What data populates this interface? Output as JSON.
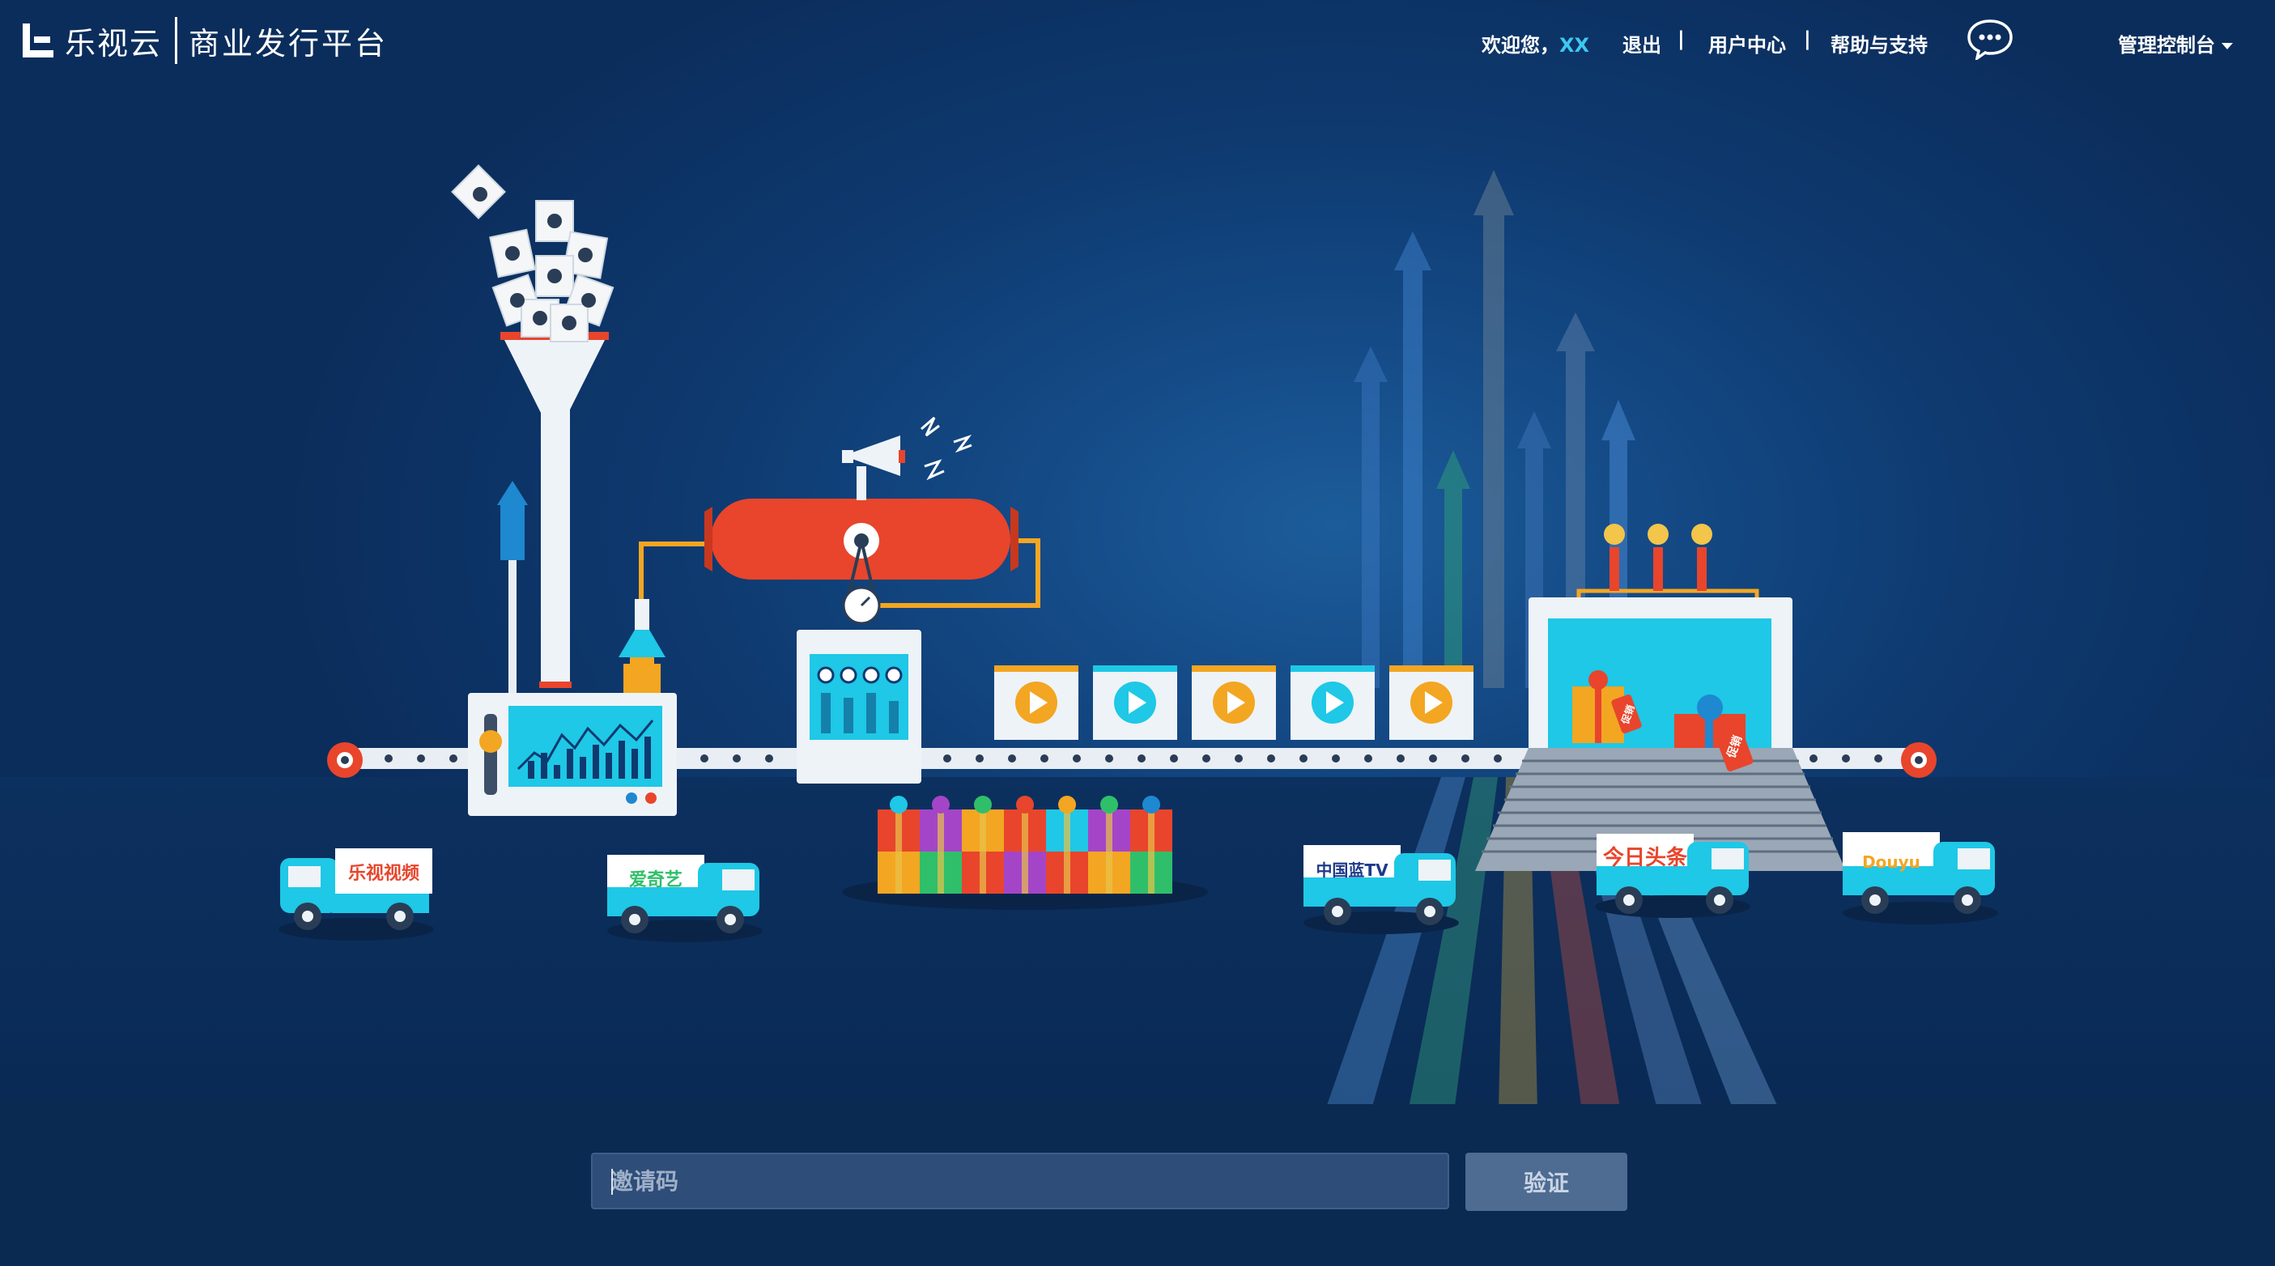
{
  "header": {
    "brand": "乐视云",
    "product": "商业发行平台",
    "welcome": "欢迎您，",
    "username": "XX",
    "logout": "退出",
    "user_center": "用户中心",
    "help": "帮助与支持",
    "console": "管理控制台",
    "separator": "|"
  },
  "scene": {
    "trucks": [
      {
        "label": "乐视视频"
      },
      {
        "label": "爱奇艺"
      },
      {
        "label": "中国蓝TV"
      },
      {
        "label": "今日头条"
      },
      {
        "label": "Douyu"
      }
    ],
    "tags": [
      "促销",
      "促销"
    ]
  },
  "invite": {
    "placeholder": "邀请码",
    "verify_label": "验证"
  },
  "colors": {
    "background": "#0e3a70",
    "accent": "#3ec8ef",
    "tank_red": "#e8452c",
    "cyan": "#1ec8e6",
    "yellow": "#f3a622"
  }
}
